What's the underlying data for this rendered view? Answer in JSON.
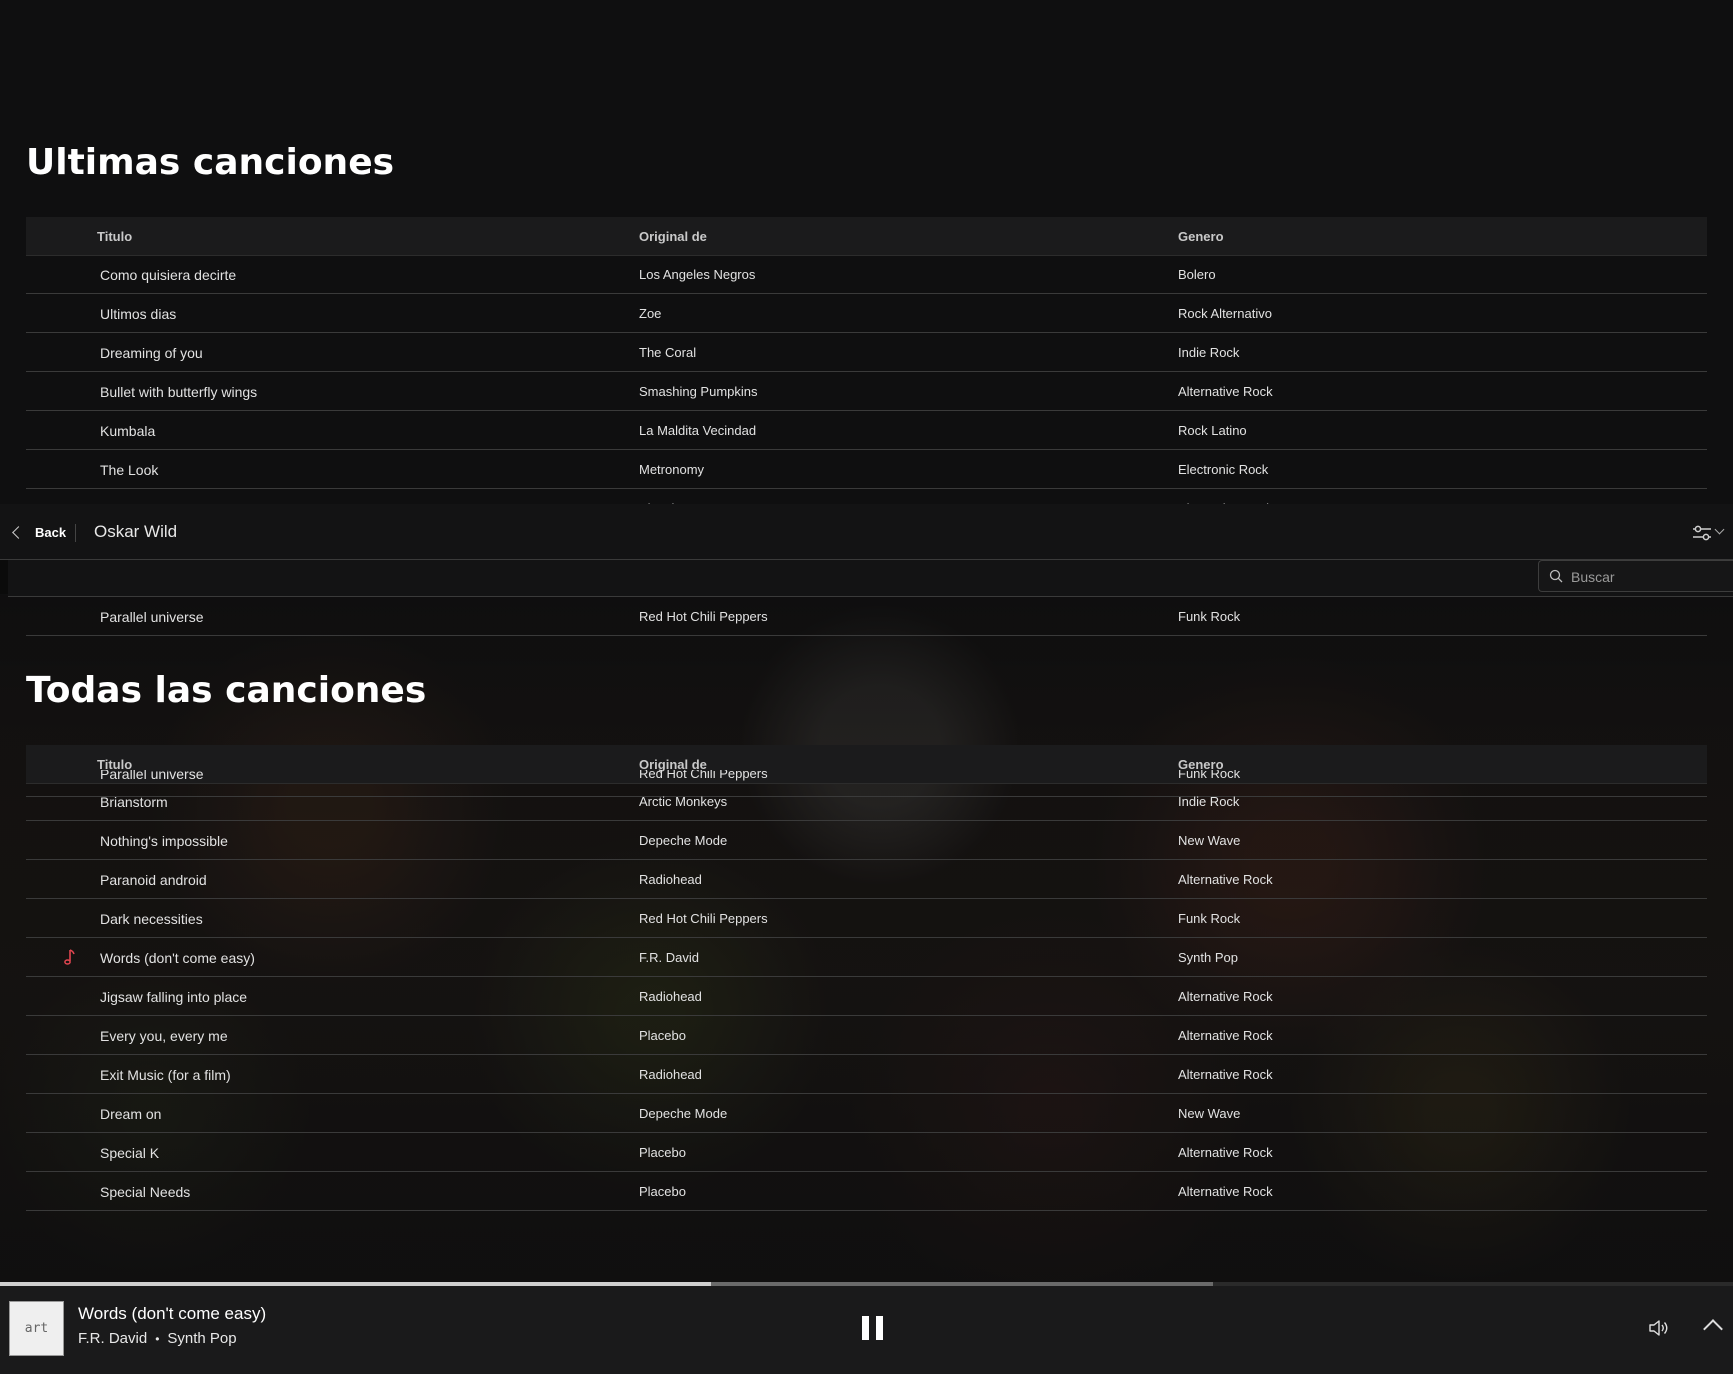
{
  "sections": {
    "ultimas": {
      "title": "Ultimas canciones",
      "columns": [
        "Titulo",
        "Original de",
        "Genero"
      ],
      "rows": [
        {
          "title": "Como quisiera decirte",
          "artist": "Los Angeles Negros",
          "genre": "Bolero"
        },
        {
          "title": "Ultimos dias",
          "artist": "Zoe",
          "genre": "Rock Alternativo"
        },
        {
          "title": "Dreaming of you",
          "artist": "The Coral",
          "genre": "Indie Rock"
        },
        {
          "title": "Bullet with butterfly wings",
          "artist": "Smashing Pumpkins",
          "genre": "Alternative Rock"
        },
        {
          "title": "Kumbala",
          "artist": "La Maldita Vecindad",
          "genre": "Rock Latino"
        },
        {
          "title": "The Look",
          "artist": "Metronomy",
          "genre": "Electronic Rock"
        },
        {
          "title": "Every you, every me",
          "artist": "Placebo",
          "genre": "Alternative Rock"
        }
      ],
      "last_row": {
        "title": "Parallel universe",
        "artist": "Red Hot Chili Peppers",
        "genre": "Funk Rock"
      }
    },
    "todas": {
      "title": "Todas las canciones",
      "columns": [
        "Titulo",
        "Original de",
        "Genero"
      ],
      "partial_row": {
        "title": "Parallel universe",
        "artist": "Red Hot Chili Peppers",
        "genre": "Funk Rock"
      },
      "rows": [
        {
          "title": "Brianstorm",
          "artist": "Arctic Monkeys",
          "genre": "Indie Rock"
        },
        {
          "title": "Nothing's impossible",
          "artist": "Depeche Mode",
          "genre": "New Wave"
        },
        {
          "title": "Paranoid android",
          "artist": "Radiohead",
          "genre": "Alternative Rock"
        },
        {
          "title": "Dark necessities",
          "artist": "Red Hot Chili Peppers",
          "genre": "Funk Rock"
        },
        {
          "title": "Words (don't come easy)",
          "artist": "F.R. David",
          "genre": "Synth Pop",
          "playing": true
        },
        {
          "title": "Jigsaw falling into place",
          "artist": "Radiohead",
          "genre": "Alternative Rock"
        },
        {
          "title": "Every you, every me",
          "artist": "Placebo",
          "genre": "Alternative Rock"
        },
        {
          "title": "Exit Music (for a film)",
          "artist": "Radiohead",
          "genre": "Alternative Rock"
        },
        {
          "title": "Dream on",
          "artist": "Depeche Mode",
          "genre": "New Wave"
        },
        {
          "title": "Special K",
          "artist": "Placebo",
          "genre": "Alternative Rock"
        },
        {
          "title": "Special Needs",
          "artist": "Placebo",
          "genre": "Alternative Rock"
        }
      ]
    }
  },
  "nav": {
    "back_label": "Back",
    "title": "Oskar Wild",
    "filter_icon": "filter-sliders-icon"
  },
  "search": {
    "placeholder": "Buscar"
  },
  "player": {
    "art_label": "art",
    "title": "Words (don't come easy)",
    "artist": "F.R. David",
    "separator": "•",
    "genre": "Synth Pop",
    "progress": 0.41,
    "buffered": 0.7
  },
  "colors": {
    "background": "#0f0f10",
    "playing_icon": "#e0454f",
    "row_divider": "#3a3a3a"
  }
}
